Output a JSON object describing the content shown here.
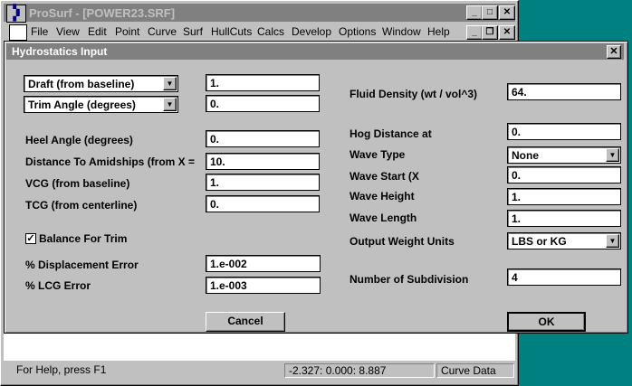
{
  "app": {
    "title": "ProSurf - [POWER23.SRF]",
    "menu": [
      "File",
      "View",
      "Edit",
      "Point",
      "Curve",
      "Surf",
      "HullCuts",
      "Calcs",
      "Develop",
      "Options",
      "Window",
      "Help"
    ],
    "titlebar_buttons": {
      "minimize": "_",
      "maximize": "□",
      "close": "✕"
    },
    "menubar_buttons": {
      "minimize": "_",
      "restore": "❐",
      "close": "✕"
    }
  },
  "dialog": {
    "title": "Hydrostatics Input",
    "close": "✕",
    "draft_combo": "Draft (from baseline)",
    "draft_value": "1.",
    "trim_combo": "Trim Angle (degrees)",
    "trim_value": "0.",
    "heel_label": "Heel Angle (degrees)",
    "heel_value": "0.",
    "amidships_label": "Distance To Amidships (from X =",
    "amidships_value": "10.",
    "vcg_label": "VCG (from baseline)",
    "vcg_value": "1.",
    "tcg_label": "TCG (from centerline)",
    "tcg_value": "0.",
    "balance_label": "Balance For Trim",
    "balance_checked": "✓",
    "disp_error_label": "% Displacement Error",
    "disp_error_value": "1.e-002",
    "lcg_error_label": "% LCG Error",
    "lcg_error_value": "1.e-003",
    "fluid_density_label": "Fluid Density (wt / vol^3)",
    "fluid_density_value": "64.",
    "hog_label": "Hog Distance at",
    "hog_value": "0.",
    "wave_type_label": "Wave Type",
    "wave_type_value": "None",
    "wave_start_label": "Wave Start (X",
    "wave_start_value": "0.",
    "wave_height_label": "Wave Height",
    "wave_height_value": "1.",
    "wave_length_label": "Wave Length",
    "wave_length_value": "1.",
    "output_units_label": "Output Weight Units",
    "output_units_value": "LBS or KG",
    "subdivision_label": "Number of Subdivision",
    "subdivision_value": "4",
    "cancel_label": "Cancel",
    "ok_label": "OK",
    "combo_arrow": "▼"
  },
  "status": {
    "help": "For Help, press F1",
    "coords": "-2.327:  0.000:  8.887",
    "mode": "Curve Data"
  }
}
